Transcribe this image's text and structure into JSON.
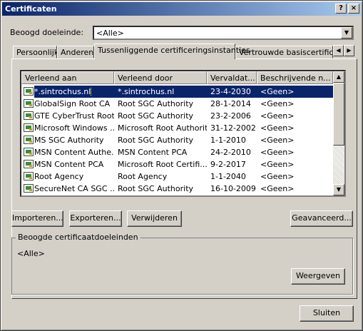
{
  "window": {
    "title": "Certificaten"
  },
  "titlebar_buttons": {
    "help": "?",
    "close": "×"
  },
  "purpose": {
    "label": "Beoogd doeleinde:",
    "label_u": "B",
    "label_rest": "eoogd doeleinde:",
    "value": "<Alle>"
  },
  "tabs": [
    {
      "label": "Persoonlijk"
    },
    {
      "label": "Anderen"
    },
    {
      "label": "Tussenliggende certificeringsinstanties"
    },
    {
      "label": "Vertrouwde basiscertificeri"
    }
  ],
  "columns": [
    "Verleend aan",
    "Verleend door",
    "Vervaldat...",
    "Beschrijvende n..."
  ],
  "rows": [
    {
      "issued_to": "*.sintrochus.nl",
      "issued_by": "*.sintrochus.nl",
      "expires": "23-4-2030",
      "name": "<Geen>",
      "selected": true
    },
    {
      "issued_to": "GlobalSign Root CA",
      "issued_by": "Root SGC Authority",
      "expires": "28-1-2014",
      "name": "<Geen>"
    },
    {
      "issued_to": "GTE CyberTrust Root",
      "issued_by": "Root SGC Authority",
      "expires": "23-2-2006",
      "name": "<Geen>"
    },
    {
      "issued_to": "Microsoft Windows ...",
      "issued_by": "Microsoft Root Authority",
      "expires": "31-12-2002",
      "name": "<Geen>"
    },
    {
      "issued_to": "MS SGC Authority",
      "issued_by": "Root SGC Authority",
      "expires": "1-1-2010",
      "name": "<Geen>"
    },
    {
      "issued_to": "MSN Content Authe...",
      "issued_by": "MSN Content PCA",
      "expires": "24-2-2010",
      "name": "<Geen>"
    },
    {
      "issued_to": "MSN Content PCA",
      "issued_by": "Microsoft Root Certifi...",
      "expires": "9-2-2017",
      "name": "<Geen>"
    },
    {
      "issued_to": "Root Agency",
      "issued_by": "Root Agency",
      "expires": "1-1-2040",
      "name": "<Geen>"
    },
    {
      "issued_to": "SecureNet CA SGC ...",
      "issued_by": "Root SGC Authority",
      "expires": "16-10-2009",
      "name": "<Geen>"
    }
  ],
  "buttons": {
    "import": "Importeren...",
    "export": "Exporteren...",
    "remove": "Verwijderen",
    "advanced": "Geavanceerd...",
    "view": "Weergeven",
    "close": "Sluiten"
  },
  "group": {
    "title": "Beoogde certificaatdoeleinden",
    "value": "<Alle>"
  }
}
